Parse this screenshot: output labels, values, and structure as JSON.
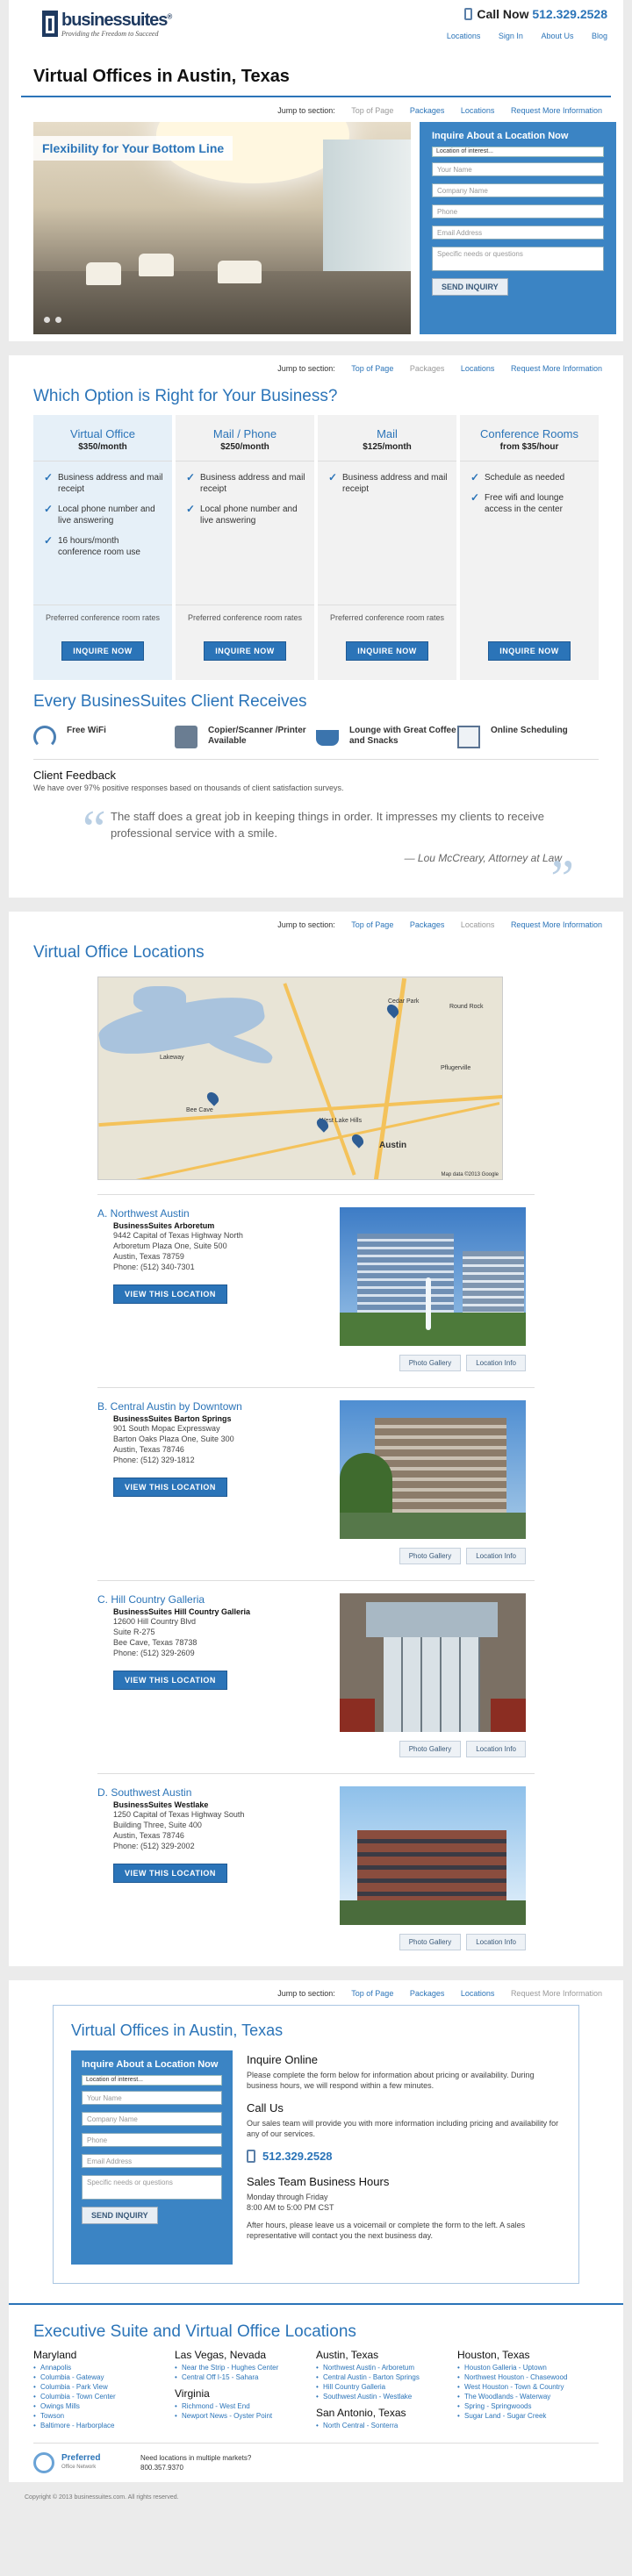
{
  "header": {
    "brand": "businessuites",
    "brand_reg": "®",
    "tagline": "Providing the Freedom to Succeed",
    "call_label": "Call Now",
    "phone": "512.329.2528",
    "links": [
      "Locations",
      "Sign In",
      "About Us",
      "Blog"
    ]
  },
  "page_title": "Virtual Offices in Austin, Texas",
  "jump": {
    "label": "Jump to section:",
    "items": [
      "Top of Page",
      "Packages",
      "Locations",
      "Request More Information"
    ]
  },
  "hero": {
    "caption": "Flexibility for Your Bottom Line"
  },
  "form": {
    "title": "Inquire About a Location Now",
    "select": "Location of interest...",
    "fields": [
      "Your Name",
      "Company Name",
      "Phone",
      "Email Address",
      "Specific needs or questions"
    ],
    "submit": "SEND INQUIRY"
  },
  "options_title": "Which Option is Right for Your Business?",
  "options": [
    {
      "name": "Virtual Office",
      "price": "$350/month",
      "features": [
        "Business address and mail receipt",
        "Local phone number and live answering",
        "16 hours/month conference room use"
      ],
      "pref": "Preferred conference room rates",
      "btn": "INQUIRE NOW"
    },
    {
      "name": "Mail / Phone",
      "price": "$250/month",
      "features": [
        "Business address and mail receipt",
        "Local phone number and live answering"
      ],
      "pref": "Preferred conference room rates",
      "btn": "INQUIRE NOW"
    },
    {
      "name": "Mail",
      "price": "$125/month",
      "features": [
        "Business address and mail receipt"
      ],
      "pref": "Preferred conference room rates",
      "btn": "INQUIRE NOW"
    },
    {
      "name": "Conference Rooms",
      "price": "from $35/hour",
      "features": [
        "Schedule as needed",
        "Free wifi and lounge access in the center"
      ],
      "pref": "",
      "btn": "INQUIRE NOW"
    }
  ],
  "every_title": "Every BusinesSuites Client Receives",
  "perks": [
    {
      "icon": "wifi-icon",
      "label": "Free WiFi"
    },
    {
      "icon": "copier-icon",
      "label": "Copier/Scanner /Printer Available"
    },
    {
      "icon": "coffee-icon",
      "label": "Lounge with Great Coffee and Snacks"
    },
    {
      "icon": "calendar-icon",
      "label": "Online Scheduling"
    }
  ],
  "feedback": {
    "title": "Client Feedback",
    "sub": "We have over 97% positive responses based on thousands of client satisfaction surveys.",
    "quote": "The staff does a great job in keeping things in order. It impresses my clients to receive professional service with a smile.",
    "author": "— Lou McCreary, Attorney at Law"
  },
  "locations_title": "Virtual Office Locations",
  "map": {
    "credit": "Map data ©2013 Google",
    "labels": [
      "Lakeway",
      "Round Rock",
      "Cedar Park",
      "Pflugerville",
      "Austin",
      "Bee Cave",
      "West Lake Hills"
    ]
  },
  "locations": [
    {
      "title": "A. Northwest Austin",
      "bldg": "BusinessSuites Arboretum",
      "addr": [
        "9442 Capital of Texas Highway North",
        "Arboretum Plaza One, Suite 500",
        "Austin, Texas 78759",
        "Phone: (512) 340-7301"
      ]
    },
    {
      "title": "B. Central Austin by Downtown",
      "bldg": "BusinessSuites Barton Springs",
      "addr": [
        "901 South Mopac Expressway",
        "Barton Oaks Plaza One, Suite 300",
        "Austin, Texas 78746",
        "Phone: (512) 329-1812"
      ]
    },
    {
      "title": "C. Hill Country Galleria",
      "bldg": "BusinessSuites Hill Country Galleria",
      "addr": [
        "12600 Hill Country Blvd",
        "Suite R-275",
        "Bee Cave, Texas 78738",
        "Phone: (512) 329-2609"
      ]
    },
    {
      "title": "D. Southwest Austin",
      "bldg": "BusinessSuites Westlake",
      "addr": [
        "1250 Capital of Texas Highway South",
        "Building Three, Suite 400",
        "Austin, Texas 78746",
        "Phone: (512) 329-2002"
      ]
    }
  ],
  "loc_btn": "VIEW THIS LOCATION",
  "photo_btn": "Photo Gallery",
  "info_btn": "Location Info",
  "contact": {
    "title": "Virtual Offices in Austin, Texas",
    "inq_h": "Inquire Online",
    "inq_p": "Please complete the form below for information about pricing or availability. During business hours, we will respond within a few minutes.",
    "call_h": "Call Us",
    "call_p": "Our sales team will provide you with more information including pricing and availability for any of our services.",
    "phone": "512.329.2528",
    "hours_h": "Sales Team Business Hours",
    "hours": [
      "Monday through Friday",
      "8:00 AM to 5:00 PM CST"
    ],
    "after": "After hours, please leave us a voicemail or complete the form to the left. A sales representative will contact you the next business day."
  },
  "footer": {
    "title": "Executive Suite and Virtual Office Locations",
    "cols": [
      [
        {
          "h": "Maryland",
          "items": [
            "Annapolis",
            "Columbia - Gateway",
            "Columbia - Park View",
            "Columbia - Town Center",
            "Owings Mills",
            "Towson",
            "Baltimore - Harborplace"
          ]
        }
      ],
      [
        {
          "h": "Las Vegas, Nevada",
          "items": [
            "Near the Strip - Hughes Center",
            "Central Off I-15 - Sahara"
          ]
        },
        {
          "h": "Virginia",
          "items": [
            "Richmond - West End",
            "Newport News - Oyster Point"
          ]
        }
      ],
      [
        {
          "h": "Austin, Texas",
          "items": [
            "Northwest Austin - Arboretum",
            "Central Austin - Barton Springs",
            "Hill Country Galleria",
            "Southwest Austin - Westlake"
          ]
        },
        {
          "h": "San Antonio, Texas",
          "items": [
            "North Central - Sonterra"
          ]
        }
      ],
      [
        {
          "h": "Houston, Texas",
          "items": [
            "Houston Galleria - Uptown",
            "Northwest Houston - Chasewood",
            "West Houston - Town & Country",
            "The Woodlands - Waterway",
            "Spring - Springwoods",
            "Sugar Land - Sugar Creek"
          ]
        }
      ]
    ],
    "pref_name": "Preferred",
    "pref_sub": "Office Network",
    "pref_text": "Need locations in multiple markets?",
    "pref_phone": "800.357.9370",
    "copyright": "Copyright © 2013 businessuites.com. All rights reserved."
  }
}
